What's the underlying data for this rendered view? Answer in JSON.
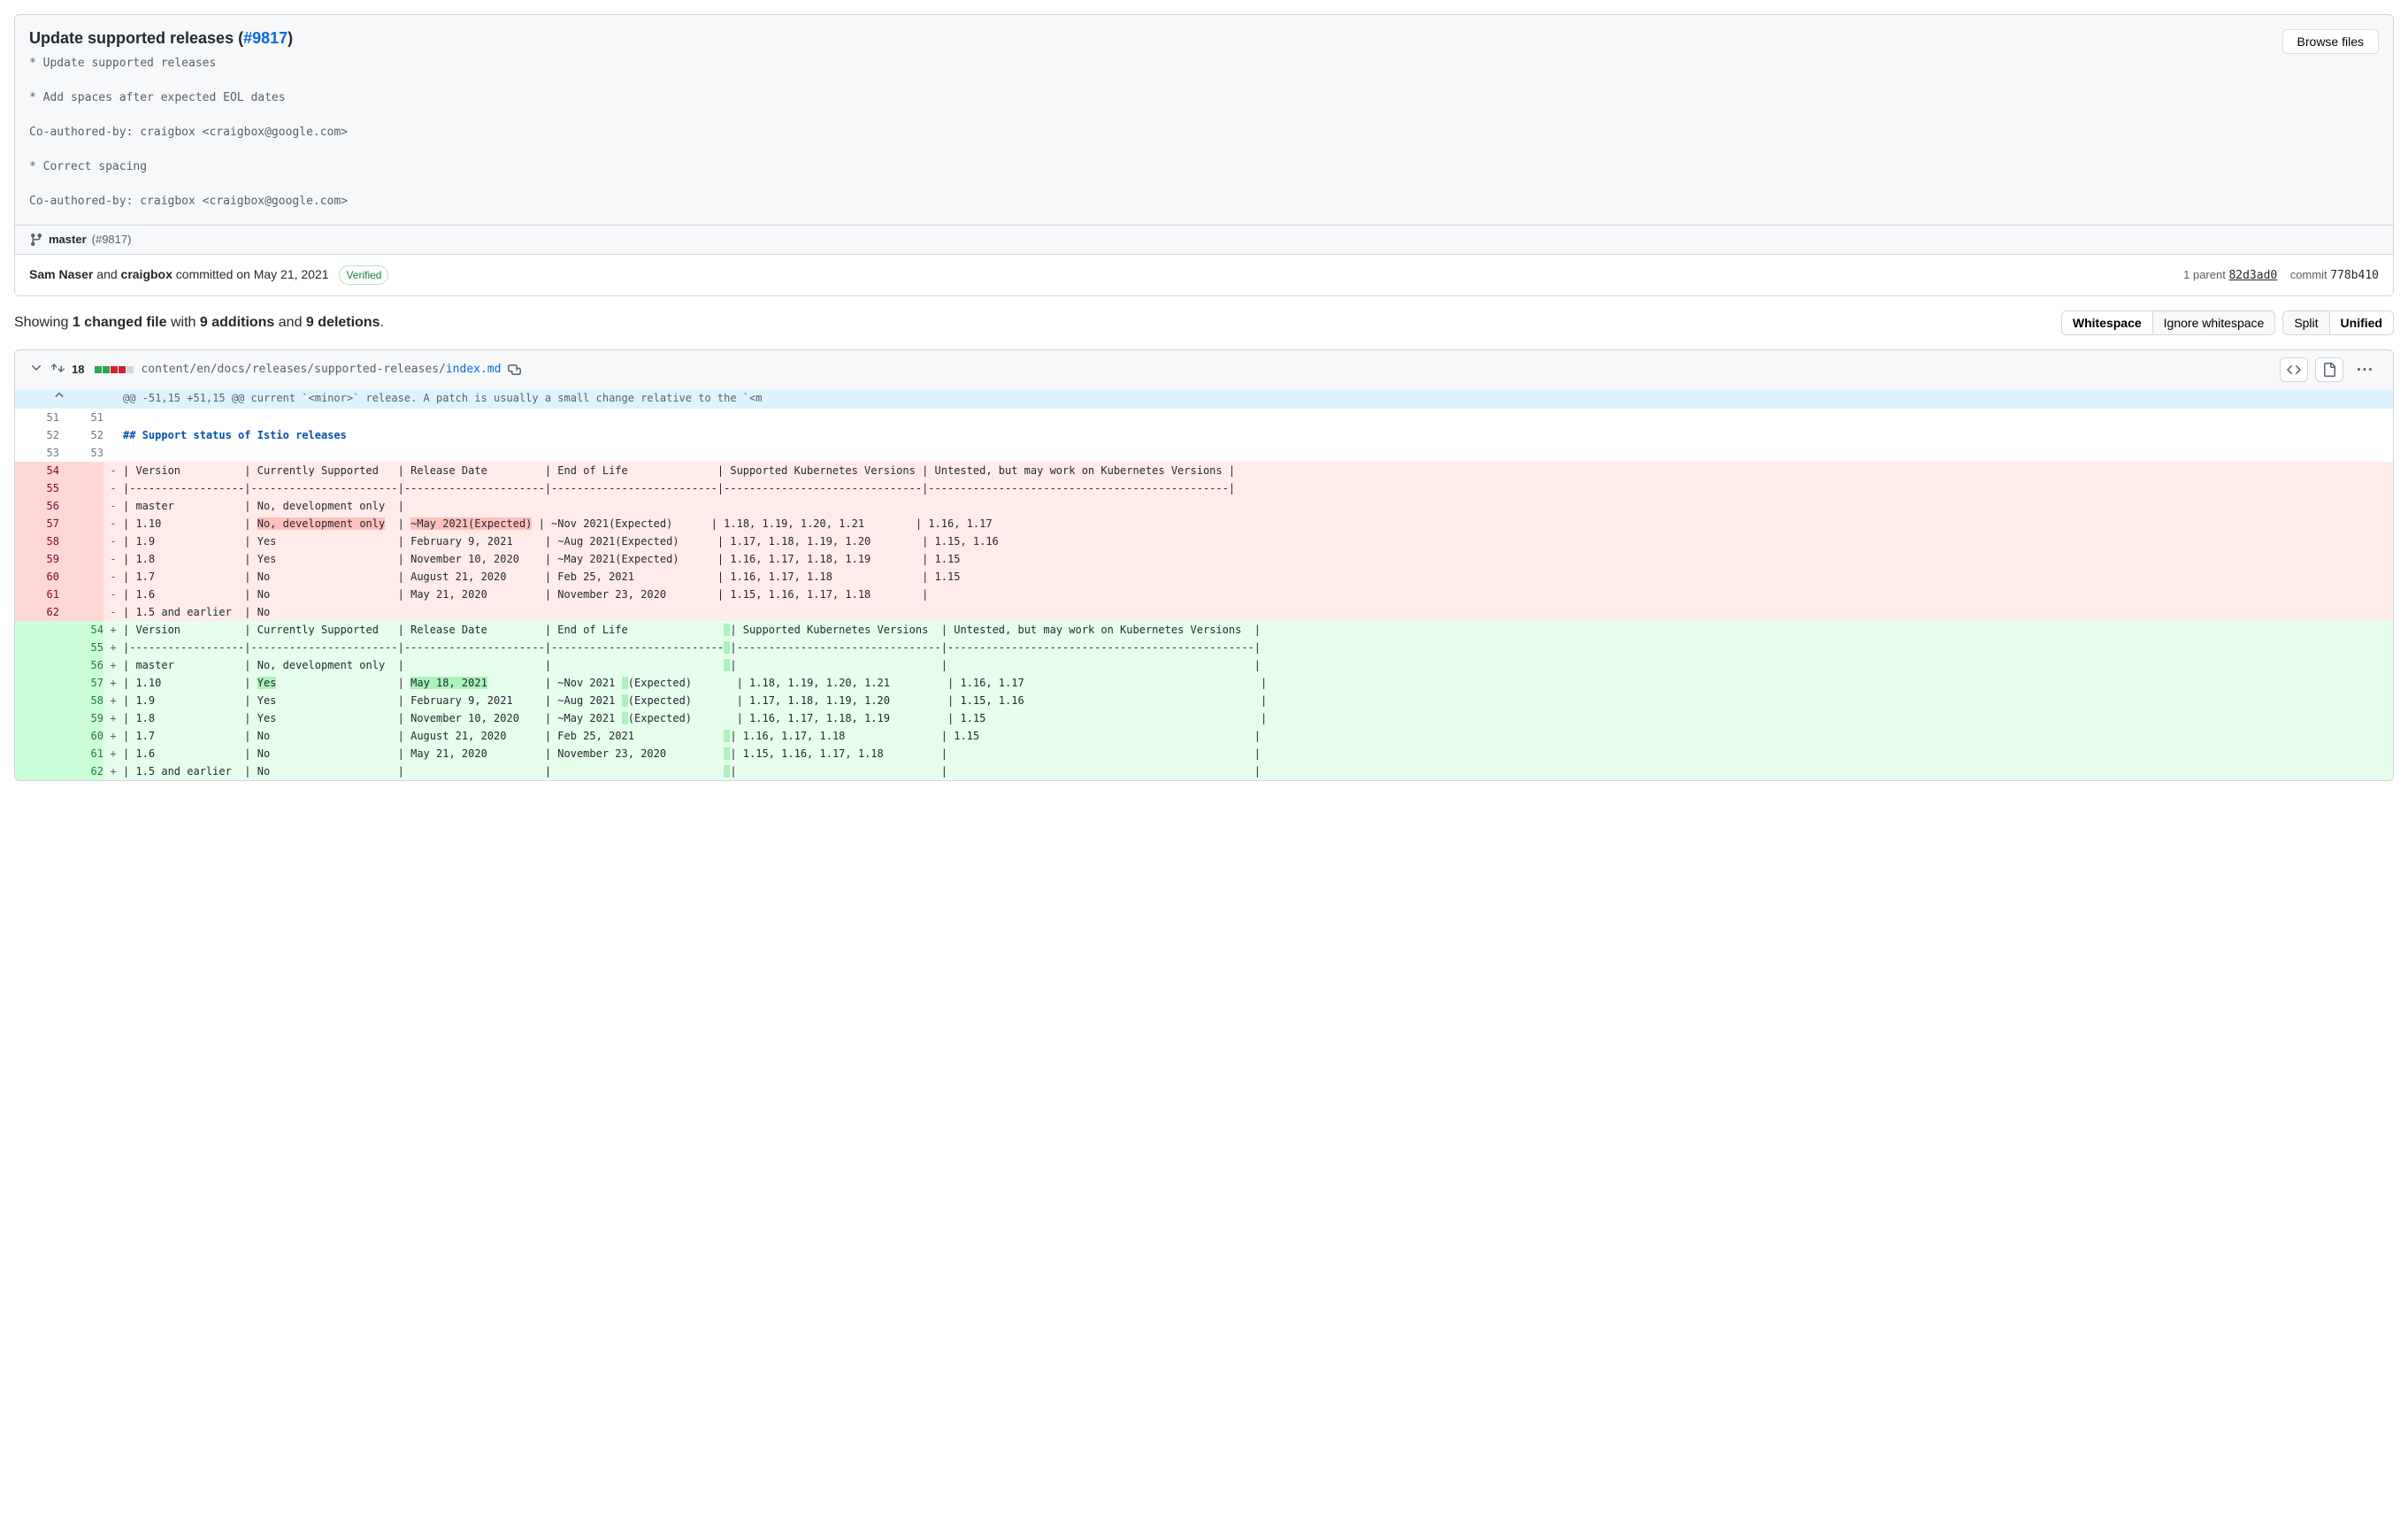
{
  "commit": {
    "title_prefix": "Update supported releases (",
    "title_link": "#9817",
    "title_suffix": ")",
    "body": "* Update supported releases\n\n* Add spaces after expected EOL dates\n\nCo-authored-by: craigbox <craigbox@google.com>\n\n* Correct spacing\n\nCo-authored-by: craigbox <craigbox@google.com>",
    "browse_files": "Browse files",
    "branch": "master",
    "branch_pr": "(#9817)",
    "author1": "Sam Naser",
    "and": " and ",
    "author2": "craigbox",
    "committed": " committed on May 21, 2021",
    "verified": "Verified",
    "parent_label": "1 parent ",
    "parent_sha": "82d3ad0",
    "commit_label": "commit ",
    "commit_sha": "778b410"
  },
  "toolbar": {
    "showing_prefix": "Showing ",
    "changed_files": "1 changed file",
    "with": " with ",
    "additions": "9 additions",
    "and": " and ",
    "deletions": "9 deletions",
    "period": ".",
    "whitespace": "Whitespace",
    "ignore_whitespace": "Ignore whitespace",
    "split": "Split",
    "unified": "Unified"
  },
  "file": {
    "count": "18",
    "path_dir": "content/en/docs/releases/supported-releases/",
    "path_file": "index.md",
    "hunk": "@@ -51,15 +51,15 @@ current `<minor>` release. A patch is usually a small change relative to the `<m"
  },
  "lines": {
    "c51": "",
    "c52": "## Support status of Istio releases",
    "c53": "",
    "d54": "| Version          | Currently Supported   | Release Date         | End of Life              | Supported Kubernetes Versions | Untested, but may work on Kubernetes Versions |",
    "d55": "|------------------|-----------------------|----------------------|--------------------------|-------------------------------|-----------------------------------------------|",
    "d56": "| master           | No, development only  |",
    "d57a": "| 1.10             | ",
    "d57b": "No, development only",
    "d57c": "  | ",
    "d57d": "~May 2021(Expected)",
    "d57e": " | ~Nov 2021(Expected)      | 1.18, 1.19, 1.20, 1.21        | 1.16, 1.17",
    "d58": "| 1.9              | Yes                   | February 9, 2021     | ~Aug 2021(Expected)      | 1.17, 1.18, 1.19, 1.20        | 1.15, 1.16",
    "d59": "| 1.8              | Yes                   | November 10, 2020    | ~May 2021(Expected)      | 1.16, 1.17, 1.18, 1.19        | 1.15",
    "d60": "| 1.7              | No                    | August 21, 2020      | Feb 25, 2021             | 1.16, 1.17, 1.18              | 1.15",
    "d61": "| 1.6              | No                    | May 21, 2020         | November 23, 2020        | 1.15, 1.16, 1.17, 1.18        |",
    "d62": "| 1.5 and earlier  | No",
    "a54a": "| Version          | Currently Supported   | Release Date         | End of Life               ",
    "a54b": "| Supported Kubernetes Versions  | Untested, but may work on Kubernetes Versions  |",
    "a55a": "|------------------|-----------------------|----------------------|---------------------------",
    "a55b": "|--------------------------------|------------------------------------------------|",
    "a56a": "| master           | No, development only  |                      |                           ",
    "a56b": "|                                |                                                |",
    "a57a": "| 1.10             | ",
    "a57b": "Yes",
    "a57c": "                   | ",
    "a57d": "May 18, 2021",
    "a57e": "         | ~Nov 2021 ",
    "a57f": "(Expected)       | 1.18, 1.19, 1.20, 1.21         | 1.16, 1.17                                     |",
    "a58a": "| 1.9              | Yes                   | February 9, 2021     | ~Aug 2021 ",
    "a58b": "(Expected)       | 1.17, 1.18, 1.19, 1.20         | 1.15, 1.16                                     |",
    "a59a": "| 1.8              | Yes                   | November 10, 2020    | ~May 2021 ",
    "a59b": "(Expected)       | 1.16, 1.17, 1.18, 1.19         | 1.15                                           |",
    "a60a": "| 1.7              | No                    | August 21, 2020      | Feb 25, 2021              ",
    "a60b": "| 1.16, 1.17, 1.18               | 1.15                                           |",
    "a61a": "| 1.6              | No                    | May 21, 2020         | November 23, 2020         ",
    "a61b": "| 1.15, 1.16, 1.17, 1.18         |                                                |",
    "a62a": "| 1.5 and earlier  | No                    |                      |                           ",
    "a62b": "|                                |                                                |"
  },
  "nums": {
    "51": "51",
    "52": "52",
    "53": "53",
    "54": "54",
    "55": "55",
    "56": "56",
    "57": "57",
    "58": "58",
    "59": "59",
    "60": "60",
    "61": "61",
    "62": "62"
  }
}
